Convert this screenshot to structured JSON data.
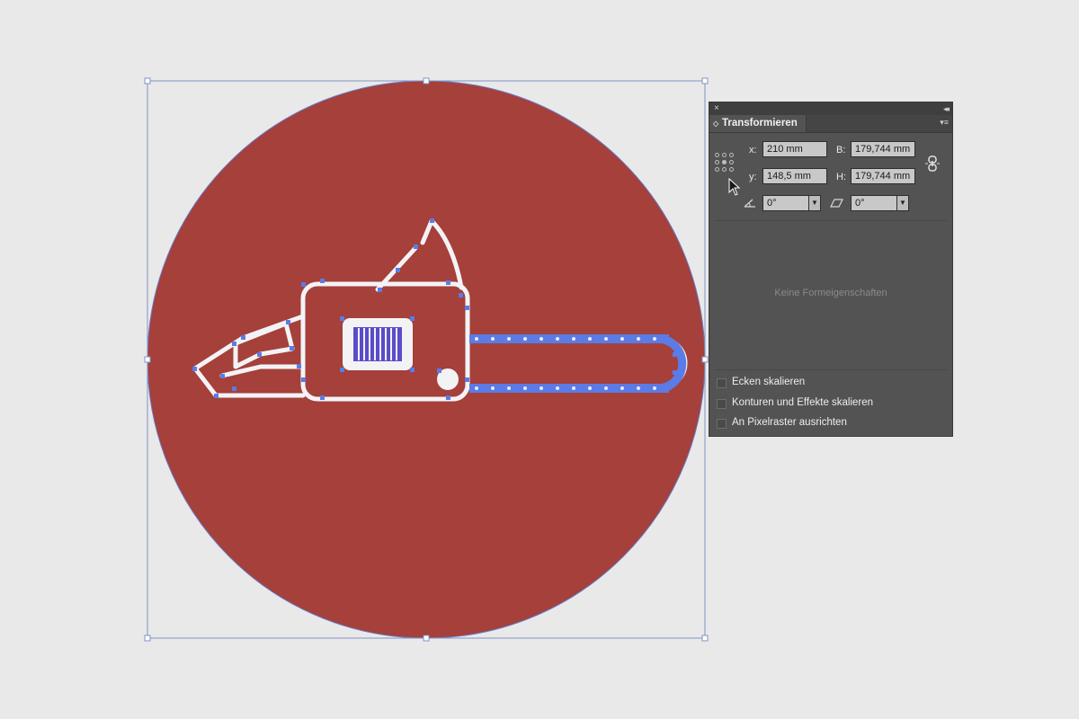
{
  "panel": {
    "title": "Transformieren",
    "close_glyph": "×",
    "collapse_glyph": "◂◂",
    "tab_arrows": "◇",
    "menu_glyph": "▾≡",
    "x_label": "x:",
    "x_value": "210 mm",
    "y_label": "y:",
    "y_value": "148,5 mm",
    "w_label": "B:",
    "w_value": "179,744 mm",
    "h_label": "H:",
    "h_value": "179,744 mm",
    "rotate_value": "0°",
    "shear_value": "0°",
    "empty_message": "Keine Formeigenschaften",
    "checkboxes": [
      {
        "label": "Ecken skalieren",
        "checked": false
      },
      {
        "label": "Konturen und Effekte skalieren",
        "checked": false
      },
      {
        "label": "An Pixelraster ausrichten",
        "checked": false
      }
    ]
  },
  "icons": {
    "rotate": "rotate-angle-icon",
    "shear": "shear-angle-icon",
    "constrain": "link-proportions-icon",
    "reference": "reference-point-icon"
  },
  "colors": {
    "circle_fill": "#a5403a",
    "icon_stroke": "#f3f3f6",
    "selection": "#5b7be6",
    "bounding_box": "#7f93c4",
    "canvas": "#e9e9e9",
    "panel_bg": "#535353"
  }
}
